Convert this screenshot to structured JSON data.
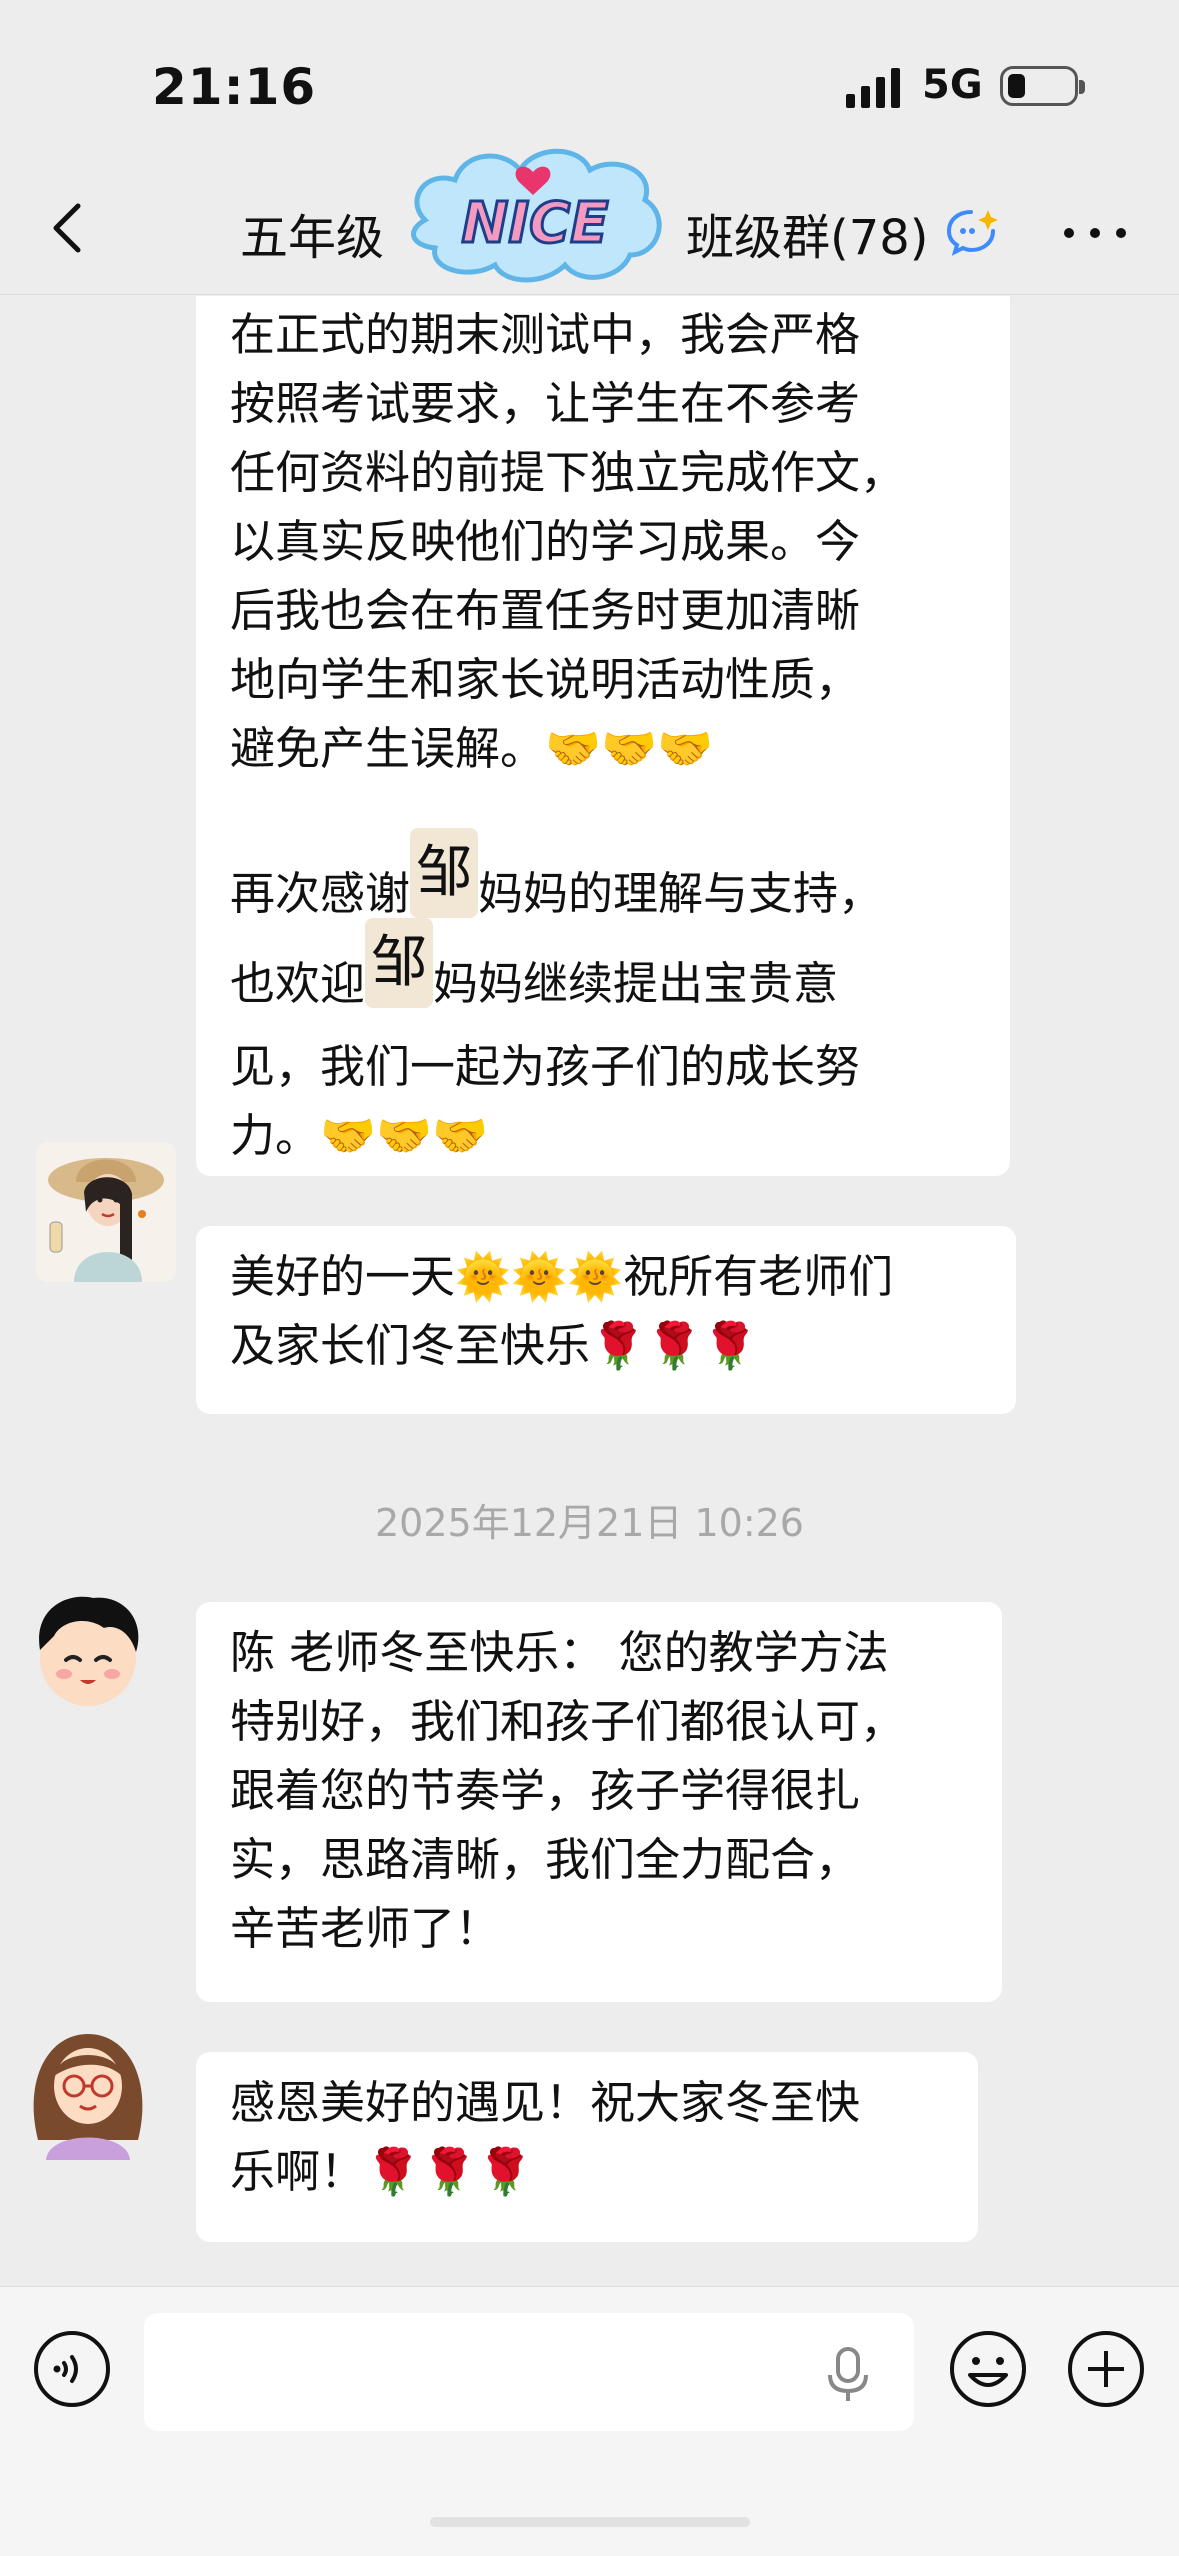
{
  "status_bar": {
    "time": "21:16",
    "network": "5G"
  },
  "header": {
    "title_left": "五年级",
    "title_right": "班级群(78)",
    "sticker_text": "NICE"
  },
  "messages": [
    {
      "text_a": "在正式的期末测试中，我会严格\n按照考试要求，让学生在不参考\n任何资料的前提下独立完成作文，\n以真实反映他们的学习成果。今\n后我也会在布置任务时更加清晰\n地向学生和家长说明活动性质，\n避免产生误解。🤝🤝🤝\n\n再次感谢",
      "name_tag_1": "邹",
      "text_b": "妈妈的理解与支持，\n也欢迎",
      "name_tag_2": "邹",
      "text_c": "妈妈继续提出宝贵意\n见，我们一起为孩子们的成长努\n力。🤝🤝🤝"
    },
    {
      "text": "美好的一天🌞🌞🌞祝所有老师们\n及家长们冬至快乐🌹🌹🌹"
    },
    {
      "text": "陈 老师冬至快乐： 您的教学方法\n特别好，我们和孩子们都很认可，\n跟着您的节奏学，孩子学得很扎\n实，思路清晰，我们全力配合，\n辛苦老师了！"
    },
    {
      "text": "感恩美好的遇见！祝大家冬至快\n乐啊！🌹🌹🌹"
    }
  ],
  "timestamp": "2025年12月21日 10:26",
  "colors": {
    "background": "#ededed",
    "bubble": "#ffffff",
    "timestamp": "#a8a8a8"
  }
}
